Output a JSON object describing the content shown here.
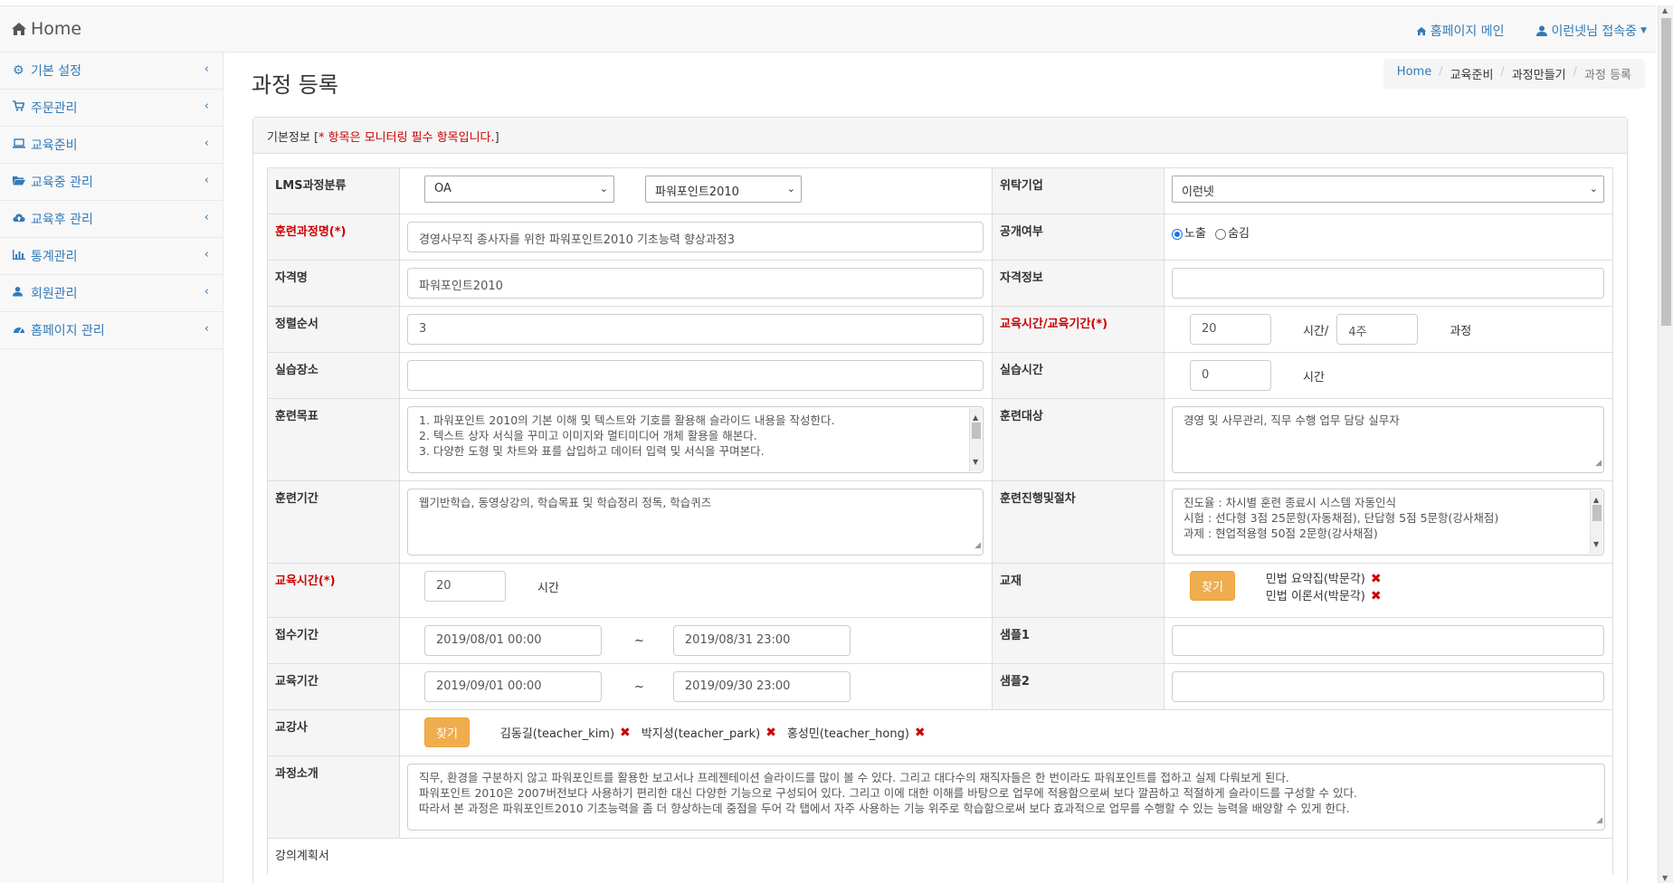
{
  "navbar": {
    "brand": "Home",
    "homepage_link": "홈페이지 메인",
    "user_menu": "이런넷님 접속중"
  },
  "sidebar": {
    "items": [
      {
        "label": "기본 설정"
      },
      {
        "label": "주문관리"
      },
      {
        "label": "교육준비"
      },
      {
        "label": "교육중 관리"
      },
      {
        "label": "교육후 관리"
      },
      {
        "label": "통계관리"
      },
      {
        "label": "회원관리"
      },
      {
        "label": "홈페이지 관리"
      }
    ]
  },
  "page": {
    "title": "과정 등록",
    "breadcrumb": [
      "Home",
      "교육준비",
      "과정만들기",
      "과정 등록"
    ]
  },
  "panel": {
    "heading_prefix": "기본정보 [",
    "heading_required": "* 항목은 모니터링 필수 항목입니다.",
    "heading_suffix": "]"
  },
  "form": {
    "lms_category_label": "LMS과정분류",
    "lms_category_1": "OA",
    "lms_category_2": "파워포인트2010",
    "consign_company_label": "위탁기업",
    "consign_company": "이런넷",
    "course_name_label": "훈련과정명(*)",
    "course_name": "경영사무직 종사자를 위한 파워포인트2010 기초능력 향상과정3",
    "public_label": "공개여부",
    "public_options": [
      "노출",
      "숨김"
    ],
    "cert_name_label": "자격명",
    "cert_name": "파워포인트2010",
    "cert_info_label": "자격정보",
    "cert_info": "",
    "sort_order_label": "정렬순서",
    "sort_order": "3",
    "edu_time_period_label": "교육시간/교육기간(*)",
    "edu_hours": "20",
    "hours_unit": "시간/",
    "edu_weeks": "4주",
    "course_unit": "과정",
    "practice_place_label": "실습장소",
    "practice_place": "",
    "practice_time_label": "실습시간",
    "practice_time": "0",
    "practice_time_unit": "시간",
    "goal_label": "훈련목표",
    "goal_lines": [
      "1. 파워포인트 2010의 기본 이해 및 텍스트와 기호를 활용해 슬라이드 내용을 작성한다.",
      "2. 텍스트 상자 서식을 꾸미고 이미지와 멀티미디어 개체 활용을 해본다.",
      "3. 다양한 도형 및 차트와 표를 삽입하고 데이터 입력 및 서식을 꾸며본다."
    ],
    "target_label": "훈련대상",
    "target": "경영 및 사무관리, 직무 수행 업무 담당 실무자",
    "period_label": "훈련기간",
    "period": "웹기반학습, 동영상강의, 학습목표 및 학습정리 정독, 학습퀴즈",
    "procedure_label": "훈련진행및절차",
    "procedure_lines": [
      "진도율 : 차시별 훈련 종료시 시스템 자동인식",
      "시험 : 선다형 3점 25문항(자동채점), 단답형 5점 5문항(강사채점)",
      "과제 : 현업적용형 50점 2문항(강사채점)"
    ],
    "edu_time_label": "교육시간(*)",
    "edu_time": "20",
    "edu_time_unit": "시간",
    "textbook_label": "교재",
    "find_label": "찾기",
    "textbooks": [
      "민법 요약집(박문각)",
      "민법 이론서(박문각)"
    ],
    "apply_period_label": "접수기간",
    "apply_start": "2019/08/01 00:00",
    "apply_end": "2019/08/31 23:00",
    "tilde": "~",
    "sample1_label": "샘플1",
    "sample1": "",
    "edu_period_label": "교육기간",
    "edu_start": "2019/09/01 00:00",
    "edu_end": "2019/09/30 23:00",
    "sample2_label": "샘플2",
    "sample2": "",
    "instructor_label": "교강사",
    "instructors": [
      "김동길(teacher_kim)",
      "박지성(teacher_park)",
      "홍성민(teacher_hong)"
    ],
    "intro_label": "과정소개",
    "intro_lines": [
      "직무, 환경을 구분하지 않고 파워포인트를 활용한 보고서나 프레젠테이션 슬라이드를 많이 볼 수 있다. 그리고 대다수의 재직자들은 한 번이라도 파워포인트를 접하고 실제 다뤄보게 된다.",
      "파워포인트 2010은 2007버전보다 사용하기 편리한 대신 다양한 기능으로 구성되어 있다. 그리고 이에 대한 이해를 바탕으로 업무에 적용함으로써 보다 깔끔하고 적절하게 슬라이드를 구성할 수 있다.",
      "따라서 본 과정은 파워포인트2010 기초능력을 좀 더 향상하는데 중점을 두어 각 탭에서 자주 사용하는 기능 위주로 학습함으로써 보다 효과적으로 업무를 수행할 수 있는 능력을 배양할 수 있게 한다."
    ],
    "lecture_plan_label": "강의계획서"
  },
  "colors": {
    "link": "#337ab7",
    "required": "#cc0000",
    "warning_button": "#f0ad4e"
  }
}
